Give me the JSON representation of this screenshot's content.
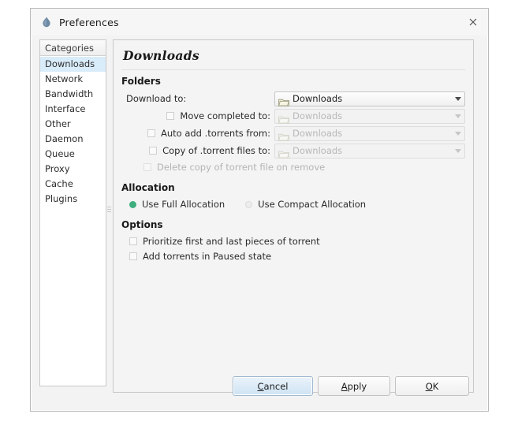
{
  "window": {
    "title": "Preferences",
    "icon": "deluge-droplet-icon",
    "close_label": "×"
  },
  "sidebar": {
    "header": "Categories",
    "selected": "Downloads",
    "items": [
      {
        "label": "Downloads"
      },
      {
        "label": "Network"
      },
      {
        "label": "Bandwidth"
      },
      {
        "label": "Interface"
      },
      {
        "label": "Other"
      },
      {
        "label": "Daemon"
      },
      {
        "label": "Queue"
      },
      {
        "label": "Proxy"
      },
      {
        "label": "Cache"
      },
      {
        "label": "Plugins"
      }
    ]
  },
  "panel": {
    "title": "Downloads",
    "folders": {
      "heading": "Folders",
      "rows": [
        {
          "label": "Download to:",
          "value": "Downloads",
          "checkbox": false,
          "has_checkbox": false,
          "enabled": true
        },
        {
          "label": "Move completed to:",
          "value": "Downloads",
          "checkbox": false,
          "has_checkbox": true,
          "enabled": false
        },
        {
          "label": "Auto add .torrents from:",
          "value": "Downloads",
          "checkbox": false,
          "has_checkbox": true,
          "enabled": false
        },
        {
          "label": "Copy of .torrent files to:",
          "value": "Downloads",
          "checkbox": false,
          "has_checkbox": true,
          "enabled": false
        }
      ],
      "sub_option": {
        "label": "Delete copy of torrent file on remove",
        "checked": false,
        "enabled": false
      }
    },
    "allocation": {
      "heading": "Allocation",
      "selected": "Use Full Allocation",
      "options": [
        {
          "label": "Use Full Allocation",
          "selected": true
        },
        {
          "label": "Use Compact Allocation",
          "selected": false
        }
      ]
    },
    "options": {
      "heading": "Options",
      "items": [
        {
          "label": "Prioritize first and last pieces of torrent",
          "checked": false
        },
        {
          "label": "Add torrents in Paused state",
          "checked": false
        }
      ]
    }
  },
  "buttons": {
    "cancel": {
      "pre": "C",
      "post": "ancel",
      "focused": true
    },
    "apply": {
      "pre": "A",
      "post": "pply",
      "focused": false
    },
    "ok": {
      "pre": "O",
      "post": "K",
      "focused": false
    }
  },
  "colors": {
    "selection": "#d9ecfa",
    "radio_on": "#3fae7e",
    "panel_bg": "#f4f4f4",
    "focus_border": "#9fb9cf"
  }
}
